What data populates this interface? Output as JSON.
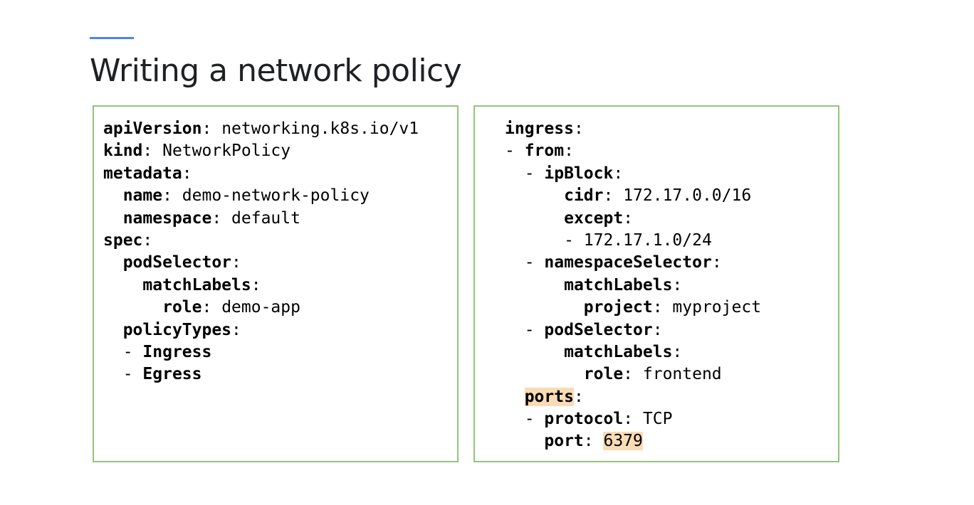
{
  "slide": {
    "title": "Writing a network policy",
    "accent_color": "#4a86e8",
    "box_border_color": "#93c47d",
    "highlight_color": "#f9dbb5"
  },
  "left_code": [
    {
      "indent": "",
      "dash": "",
      "key": "apiVersion",
      "sep": ": ",
      "value": "networking.k8s.io/v1"
    },
    {
      "indent": "",
      "dash": "",
      "key": "kind",
      "sep": ": ",
      "value": "NetworkPolicy"
    },
    {
      "indent": "",
      "dash": "",
      "key": "metadata",
      "sep": ":",
      "value": ""
    },
    {
      "indent": "  ",
      "dash": "",
      "key": "name",
      "sep": ": ",
      "value": "demo-network-policy"
    },
    {
      "indent": "  ",
      "dash": "",
      "key": "namespace",
      "sep": ": ",
      "value": "default"
    },
    {
      "indent": "",
      "dash": "",
      "key": "spec",
      "sep": ":",
      "value": ""
    },
    {
      "indent": "  ",
      "dash": "",
      "key": "podSelector",
      "sep": ":",
      "value": ""
    },
    {
      "indent": "    ",
      "dash": "",
      "key": "matchLabels",
      "sep": ":",
      "value": ""
    },
    {
      "indent": "      ",
      "dash": "",
      "key": "role",
      "sep": ": ",
      "value": "demo-app"
    },
    {
      "indent": "  ",
      "dash": "",
      "key": "policyTypes",
      "sep": ":",
      "value": ""
    },
    {
      "indent": "  ",
      "dash": "- ",
      "key": "Ingress",
      "sep": "",
      "value": ""
    },
    {
      "indent": "  ",
      "dash": "- ",
      "key": "Egress",
      "sep": "",
      "value": ""
    }
  ],
  "right_code": [
    {
      "indent": "",
      "dash": "",
      "key": "ingress",
      "sep": ":",
      "value": ""
    },
    {
      "indent": "",
      "dash": "- ",
      "key": "from",
      "sep": ":",
      "value": ""
    },
    {
      "indent": "  ",
      "dash": "- ",
      "key": "ipBlock",
      "sep": ":",
      "value": ""
    },
    {
      "indent": "      ",
      "dash": "",
      "key": "cidr",
      "sep": ": ",
      "value": "172.17.0.0/16"
    },
    {
      "indent": "      ",
      "dash": "",
      "key": "except",
      "sep": ":",
      "value": ""
    },
    {
      "indent": "      ",
      "dash": "- ",
      "key": "",
      "sep": "",
      "value": "172.17.1.0/24"
    },
    {
      "indent": "  ",
      "dash": "- ",
      "key": "namespaceSelector",
      "sep": ":",
      "value": ""
    },
    {
      "indent": "      ",
      "dash": "",
      "key": "matchLabels",
      "sep": ":",
      "value": ""
    },
    {
      "indent": "        ",
      "dash": "",
      "key": "project",
      "sep": ": ",
      "value": "myproject"
    },
    {
      "indent": "  ",
      "dash": "- ",
      "key": "podSelector",
      "sep": ":",
      "value": ""
    },
    {
      "indent": "      ",
      "dash": "",
      "key": "matchLabels",
      "sep": ":",
      "value": ""
    },
    {
      "indent": "        ",
      "dash": "",
      "key": "role",
      "sep": ": ",
      "value": "frontend"
    },
    {
      "indent": "  ",
      "dash": "",
      "key": "ports",
      "sep": ":",
      "value": "",
      "key_highlight": true
    },
    {
      "indent": "  ",
      "dash": "- ",
      "key": "protocol",
      "sep": ": ",
      "value": "TCP"
    },
    {
      "indent": "    ",
      "dash": "",
      "key": "port",
      "sep": ": ",
      "value": "6379",
      "value_highlight": true
    }
  ]
}
